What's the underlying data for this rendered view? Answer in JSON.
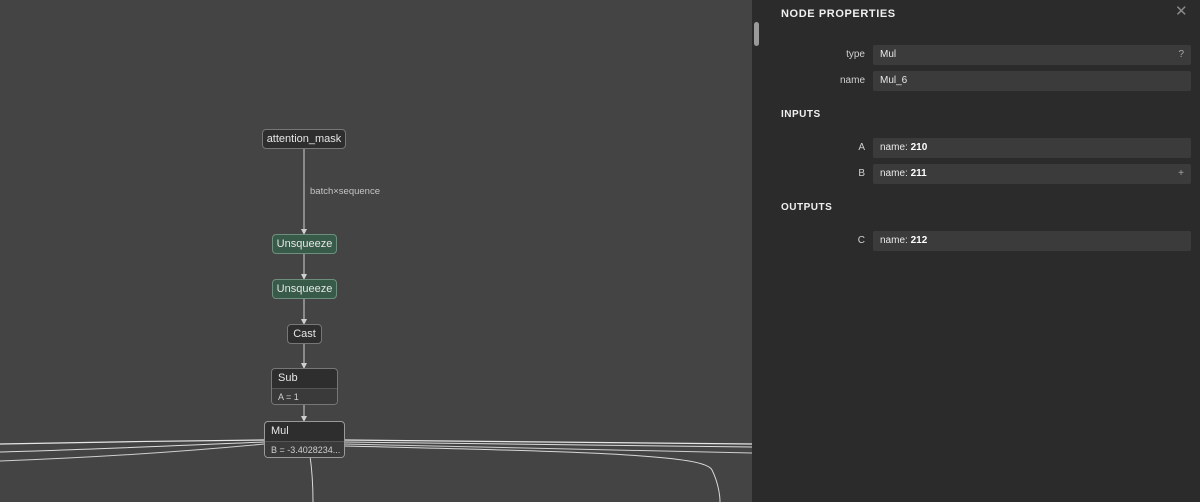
{
  "graph": {
    "nodes": {
      "attention_mask": "attention_mask",
      "unsqueeze_1": "Unsqueeze",
      "unsqueeze_2": "Unsqueeze",
      "cast": "Cast",
      "sub": {
        "name": "Sub",
        "attr": "A = 1"
      },
      "mul": {
        "name": "Mul",
        "attr": "B = -3.4028234..."
      }
    },
    "edge_label": "batch×sequence"
  },
  "panel": {
    "title": "NODE PROPERTIES",
    "close_icon": "close-icon",
    "properties": [
      {
        "label": "type",
        "value": "Mul",
        "suffix": "?"
      },
      {
        "label": "name",
        "value": "Mul_6"
      }
    ],
    "inputs_title": "INPUTS",
    "inputs": [
      {
        "label": "A",
        "prefix": "name: ",
        "value": "210"
      },
      {
        "label": "B",
        "prefix": "name: ",
        "value": "211",
        "suffix": "+"
      }
    ],
    "outputs_title": "OUTPUTS",
    "outputs": [
      {
        "label": "C",
        "prefix": "name: ",
        "value": "212"
      }
    ]
  },
  "colors": {
    "canvas_bg": "#444444",
    "panel_bg": "#2b2b2b",
    "node_bg": "#2e2e2e",
    "node_green": "#385a49",
    "field_bg": "#3b3b3b"
  }
}
